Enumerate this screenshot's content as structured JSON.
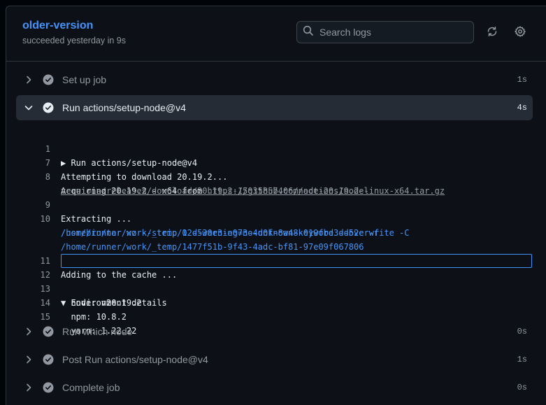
{
  "header": {
    "job_name": "older-version",
    "job_status": "succeeded yesterday in 9s",
    "search_placeholder": "Search logs"
  },
  "steps": [
    {
      "name": "Set up job",
      "duration": "1s",
      "expanded": false
    },
    {
      "name": "Run actions/setup-node@v4",
      "duration": "4s",
      "expanded": true
    },
    {
      "name": "Run which node",
      "duration": "0s",
      "expanded": false
    },
    {
      "name": "Post Run actions/setup-node@v4",
      "duration": "1s",
      "expanded": false
    },
    {
      "name": "Complete job",
      "duration": "0s",
      "expanded": false
    }
  ],
  "log": {
    "line1": {
      "num": "1",
      "text": "▶ Run actions/setup-node@v4"
    },
    "line7": {
      "num": "7",
      "text": "Attempting to download 20.19.2..."
    },
    "line8": {
      "num": "8",
      "prefix": "Acquiring 20.19.2 - x64 from ",
      "url_a": "https://github.com/actions/node-",
      "url_b": "versions/releases/download/20.19.2-15035857406/node-20.19.2-linux-x64.tar.gz"
    },
    "line9": {
      "num": "9",
      "text": "Extracting ..."
    },
    "line10": {
      "num": "10",
      "text_a": "/usr/bin/tar xz --strip 1 --warning=no-unknown-keyword --overwrite -C",
      "text_b": "/home/runner/work/_temp/02d530e3-e073-4d0f-8a48-019fbe3dd52e -f",
      "text_c": "/home/runner/work/_temp/1477f51b-9f43-4adc-bf81-97e09f067806"
    },
    "line11": {
      "num": "11",
      "text": "Adding to the cache ..."
    },
    "line12": {
      "num": "12",
      "text": "▼ Environment details"
    },
    "line13": {
      "num": "13",
      "text": "  node: v20.19.2"
    },
    "line14": {
      "num": "14",
      "text": "  npm: 10.8.2"
    },
    "line15": {
      "num": "15",
      "text": "  yarn: 1.22.22"
    }
  },
  "colors": {
    "accent": "#4493f8",
    "background": "#0d1117",
    "muted": "#9198a1"
  }
}
